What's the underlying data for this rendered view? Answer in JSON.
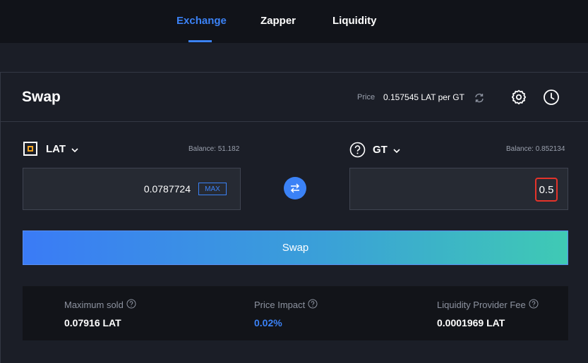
{
  "nav": {
    "tabs": [
      {
        "label": "Exchange",
        "active": true
      },
      {
        "label": "Zapper",
        "active": false
      },
      {
        "label": "Liquidity",
        "active": false
      }
    ]
  },
  "swap": {
    "title": "Swap",
    "price_label": "Price",
    "price_value": "0.157545 LAT per GT",
    "icons": [
      "refresh-icon",
      "gear-icon",
      "clock-icon"
    ]
  },
  "from": {
    "token": "LAT",
    "balance": "Balance: 51.182",
    "amount": "0.0787724",
    "max_label": "MAX"
  },
  "to": {
    "token": "GT",
    "balance": "Balance: 0.852134",
    "amount": "0.5"
  },
  "swap_button_label": "Swap",
  "info": {
    "max_sold_label": "Maximum sold",
    "max_sold_value": "0.07916 LAT",
    "price_impact_label": "Price Impact",
    "price_impact_value": "0.02%",
    "lp_fee_label": "Liquidity Provider Fee",
    "lp_fee_value": "0.0001969 LAT"
  },
  "colors": {
    "accent": "#3b82f6",
    "highlight": "#e5332a",
    "gradient_start": "#3a7bf6",
    "gradient_end": "#3fcab4"
  }
}
